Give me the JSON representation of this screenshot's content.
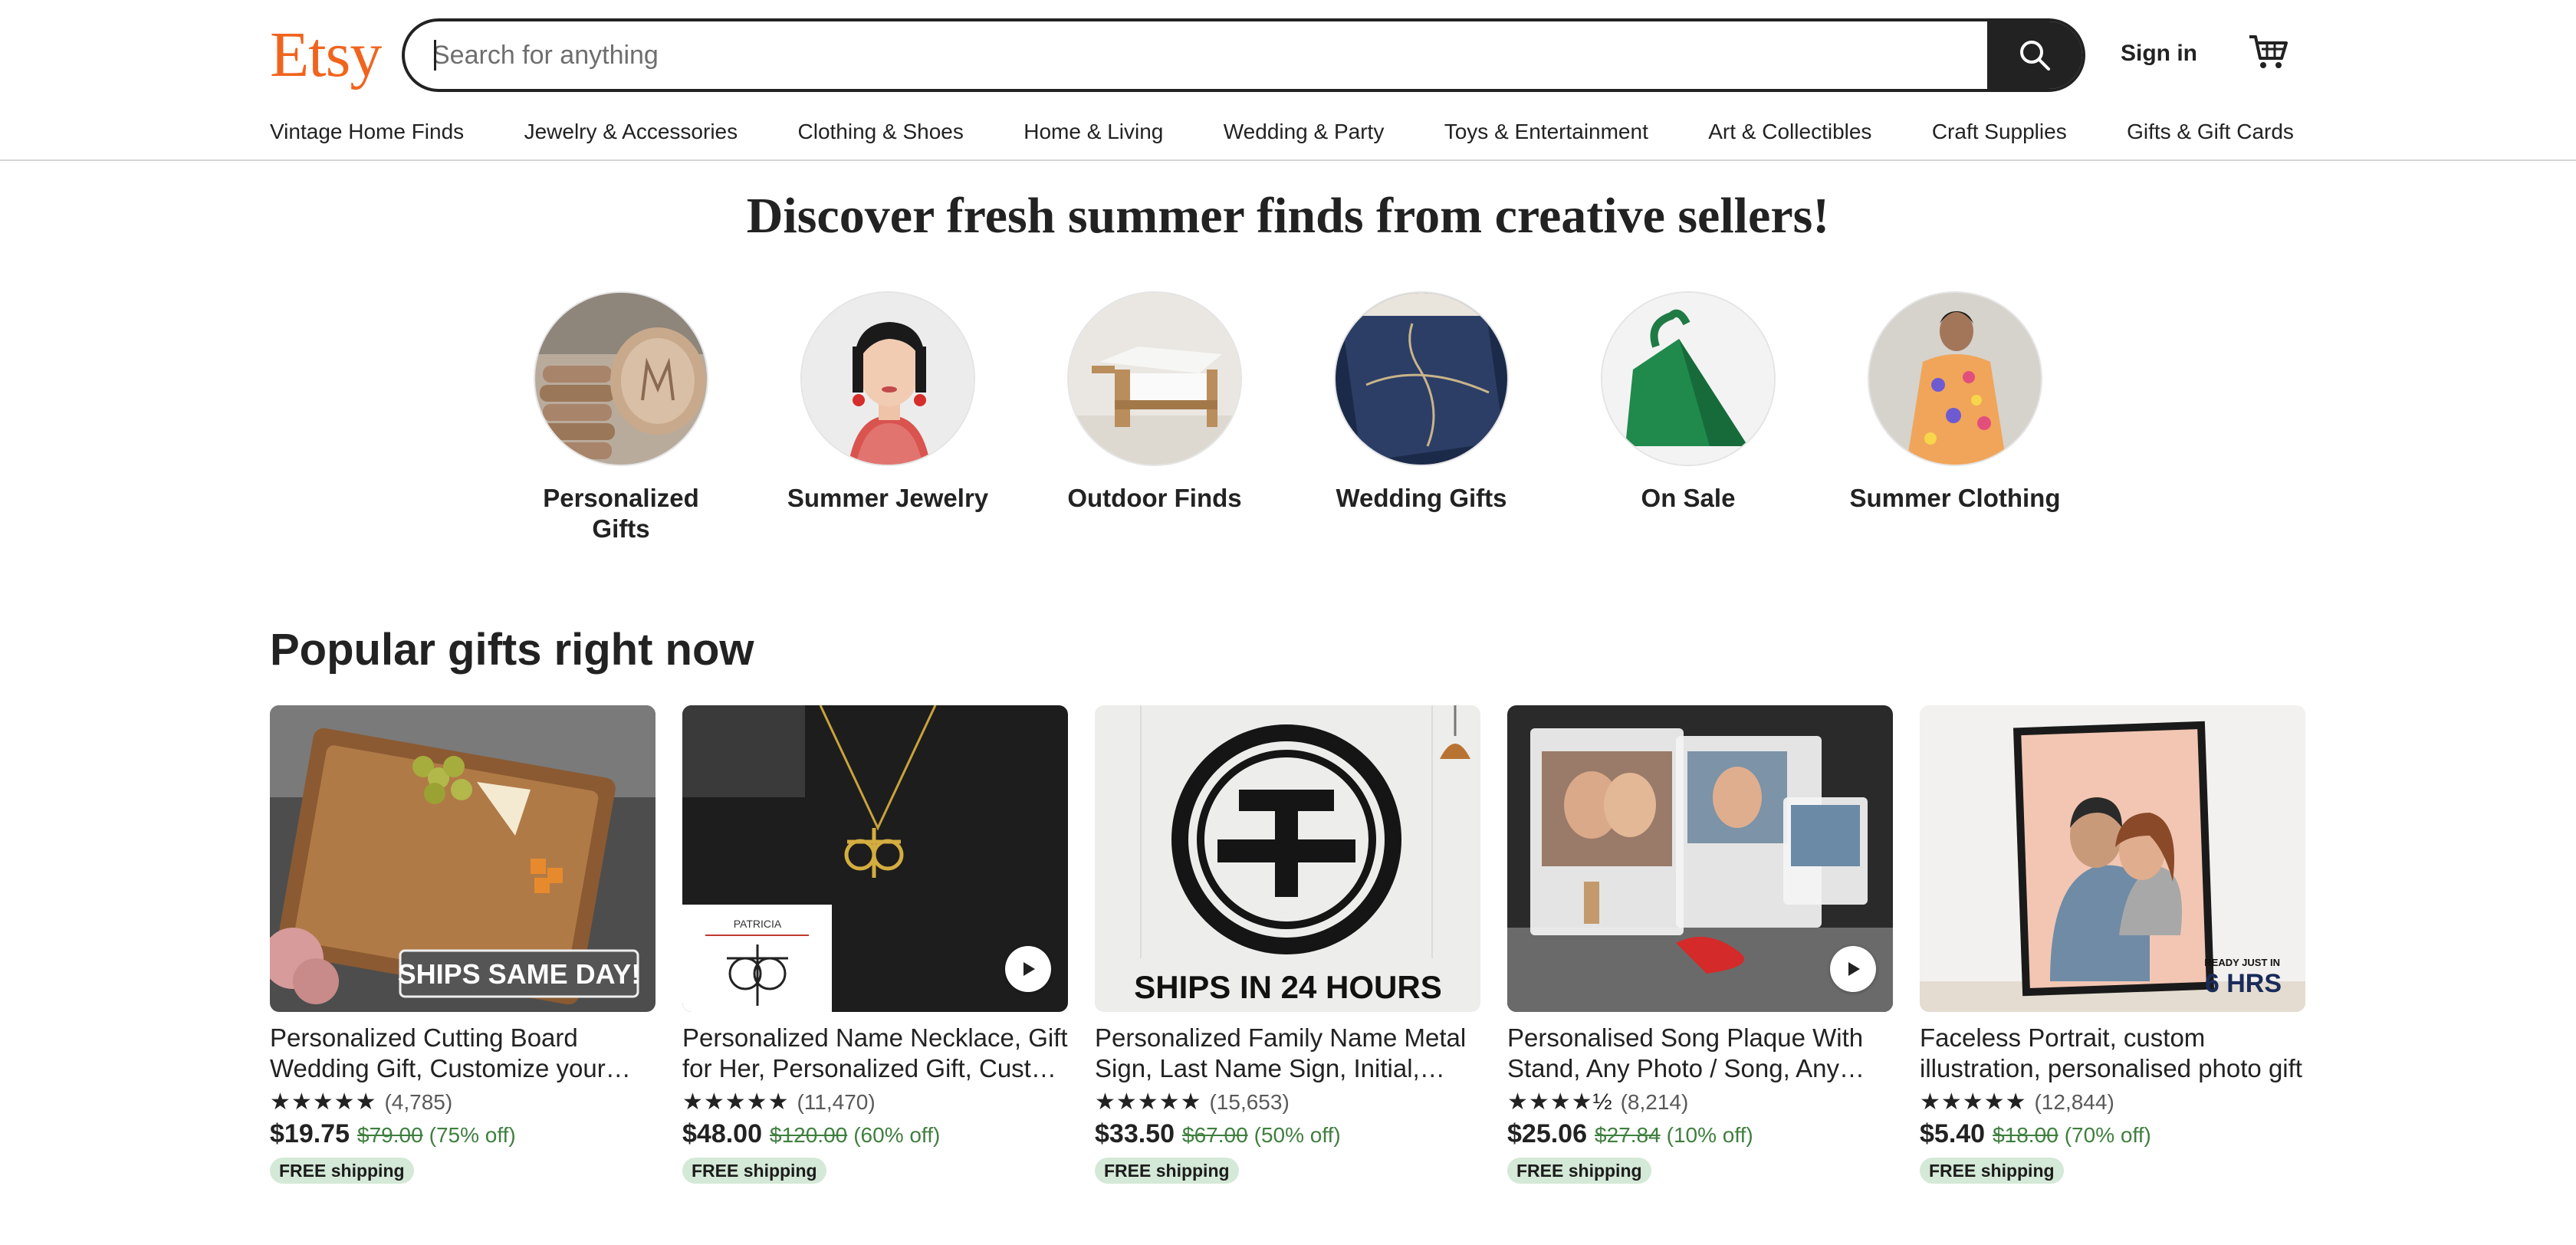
{
  "header": {
    "logo": "Etsy",
    "search_placeholder": "Search for anything",
    "sign_in": "Sign in"
  },
  "categories": [
    "Vintage Home Finds",
    "Jewelry & Accessories",
    "Clothing & Shoes",
    "Home & Living",
    "Wedding & Party",
    "Toys & Entertainment",
    "Art & Collectibles",
    "Craft Supplies",
    "Gifts & Gift Cards"
  ],
  "hero": {
    "title": "Discover fresh summer finds from creative sellers!",
    "circles": [
      {
        "label": "Personalized Gifts"
      },
      {
        "label": "Summer Jewelry"
      },
      {
        "label": "Outdoor Finds"
      },
      {
        "label": "Wedding Gifts"
      },
      {
        "label": "On Sale"
      },
      {
        "label": "Summer Clothing"
      }
    ]
  },
  "popular": {
    "title": "Popular gifts right now",
    "items": [
      {
        "title": "Personalized Cutting Board Wedding Gift, Customize your Engraved Wood Board",
        "rating": "★★★★★",
        "reviews": "(4,785)",
        "price": "$19.75",
        "original": "$79.00",
        "discount": "(75% off)",
        "badge": "FREE shipping",
        "image_text": "SHIPS SAME DAY!"
      },
      {
        "title": "Personalized Name Necklace, Gift for Her, Personalized Gift, Custom Jewelry",
        "rating": "★★★★★",
        "reviews": "(11,470)",
        "price": "$48.00",
        "original": "$120.00",
        "discount": "(60% off)",
        "badge": "FREE shipping",
        "image_text": "PATRICIA"
      },
      {
        "title": "Personalized Family Name Metal Sign, Last Name Sign, Initial, Wedding Gift",
        "rating": "★★★★★",
        "reviews": "(15,653)",
        "price": "$33.50",
        "original": "$67.00",
        "discount": "(50% off)",
        "badge": "FREE shipping",
        "image_text": "SHIPS IN 24 HOURS"
      },
      {
        "title": "Personalised Song Plaque With Stand, Any Photo / Song, Any Album Cover",
        "rating": "★★★★½",
        "reviews": "(8,214)",
        "price": "$25.06",
        "original": "$27.84",
        "discount": "(10% off)",
        "badge": "FREE shipping",
        "image_text": ""
      },
      {
        "title": "Faceless Portrait, custom illustration, personalised photo gift",
        "rating": "★★★★★",
        "reviews": "(12,844)",
        "price": "$5.40",
        "original": "$18.00",
        "discount": "(70% off)",
        "badge": "FREE shipping",
        "image_text": "READY JUST IN 6 HRS"
      }
    ]
  },
  "colors": {
    "brand": "#f1641e",
    "text": "#222222",
    "discount": "#3f7f3f",
    "badge_bg": "#d4e9d7"
  }
}
